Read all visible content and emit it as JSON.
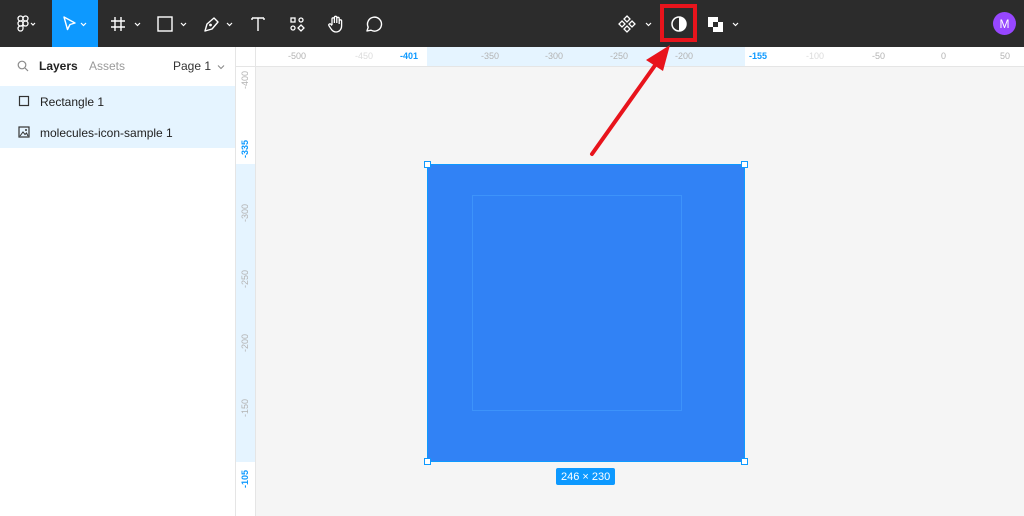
{
  "colors": {
    "toolbar_bg": "#2c2c2c",
    "accent": "#0d99ff",
    "rectangle_fill": "#3182f5",
    "avatar": "#9747ff",
    "annotation": "#e8141c"
  },
  "toolbar": {
    "left_tools": [
      "figma-menu-icon",
      "move-tool-icon",
      "frame-tool-icon",
      "rectangle-tool-icon",
      "pen-tool-icon",
      "text-tool-icon",
      "resources-icon",
      "hand-tool-icon",
      "comment-tool-icon"
    ],
    "center_tools": [
      "component-icon",
      "mask-icon",
      "boolean-icon"
    ],
    "avatar_initial": "M"
  },
  "left_panel": {
    "tabs": {
      "layers": "Layers",
      "assets": "Assets",
      "page": "Page 1"
    },
    "layers": [
      {
        "name": "Rectangle 1",
        "icon": "rectangle-layer-icon"
      },
      {
        "name": "molecules-icon-sample 1",
        "icon": "image-layer-icon"
      }
    ]
  },
  "ruler_top": {
    "labels": [
      "-500",
      "-450",
      "-401",
      "-350",
      "-300",
      "-250",
      "-200",
      "-155",
      "-100",
      "-50",
      "0",
      "50"
    ]
  },
  "ruler_left": {
    "labels": [
      "-400",
      "-335",
      "-300",
      "-250",
      "-200",
      "-150",
      "-105"
    ]
  },
  "selection": {
    "size_label": "246 × 230"
  }
}
